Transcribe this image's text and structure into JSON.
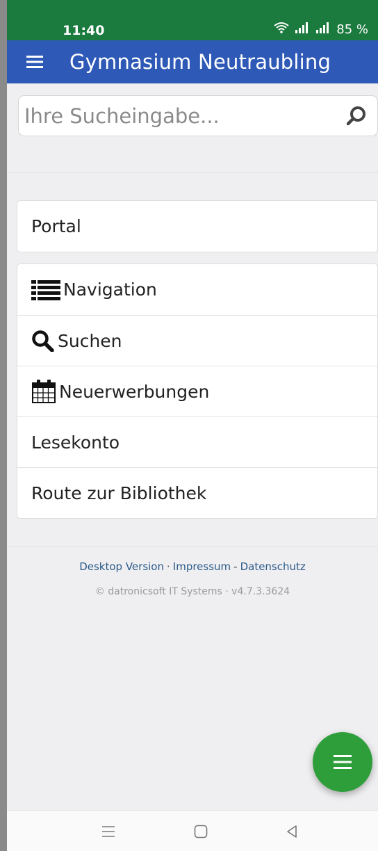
{
  "status_bar": {
    "time": "11:40",
    "battery": "85 %"
  },
  "app_bar": {
    "title": "Gymnasium Neutraubling"
  },
  "search": {
    "placeholder": "Ihre Sucheingabe..."
  },
  "portal": {
    "label": "Portal"
  },
  "menu": {
    "items": [
      {
        "label": "Navigation",
        "icon": "list-icon"
      },
      {
        "label": "Suchen",
        "icon": "search-icon"
      },
      {
        "label": "Neuerwerbungen",
        "icon": "calendar-icon"
      },
      {
        "label": "Lesekonto",
        "icon": ""
      },
      {
        "label": "Route zur Bibliothek",
        "icon": ""
      }
    ]
  },
  "footer": {
    "desktop_version": "Desktop Version",
    "dot_separator": "·",
    "impressum": "Impressum",
    "dash_separator": "-",
    "datenschutz": "Datenschutz",
    "copyright": "© datronicsoft IT Systems · v4.7.3.3624"
  },
  "colors": {
    "status_bar": "#1b7a3e",
    "app_bar": "#2e59b6",
    "fab": "#2e9e3a",
    "link": "#2a5a8a"
  }
}
